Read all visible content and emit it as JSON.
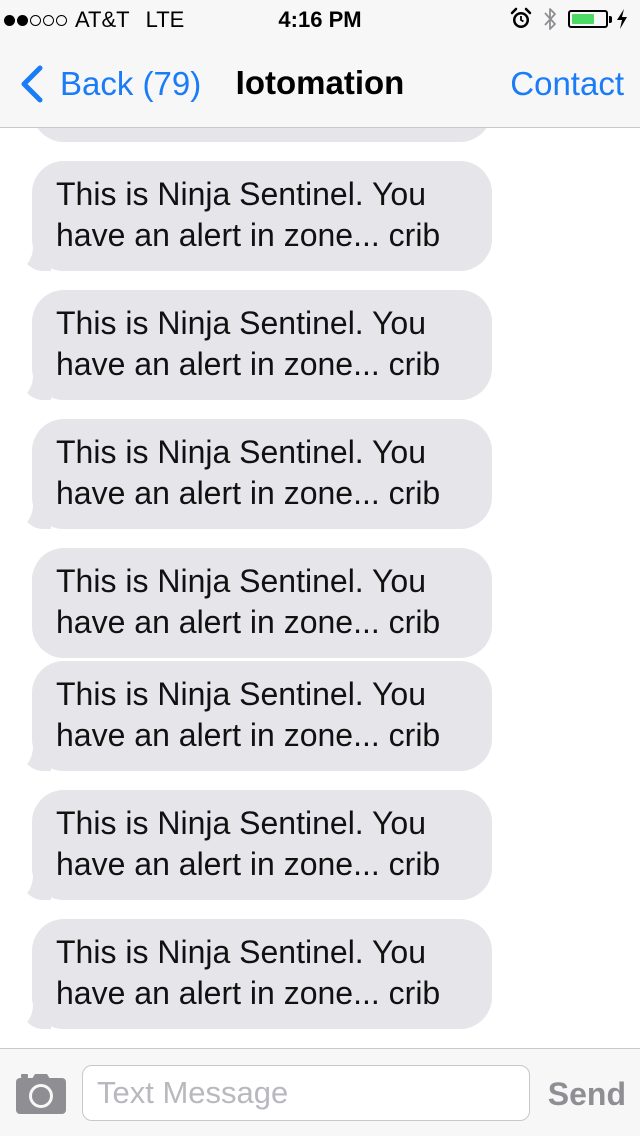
{
  "status_bar": {
    "signal_bars_filled": 2,
    "signal_bars_total": 5,
    "carrier": "AT&T",
    "network": "LTE",
    "time": "4:16 PM",
    "icons": [
      "alarm-icon",
      "bluetooth-icon",
      "battery-icon",
      "charging-icon"
    ],
    "battery_level": 0.68
  },
  "nav": {
    "back_label": "Back (79)",
    "title": "Iotomation",
    "contact_label": "Contact"
  },
  "messages": [
    "This is Ninja Sentinel. You have an alert in zone... crib",
    "This is Ninja Sentinel. You have an alert in zone... crib",
    "This is Ninja Sentinel. You have an alert in zone... crib",
    "This is Ninja Sentinel. You have an alert in zone... crib",
    "This is Ninja Sentinel. You have an alert in zone... crib",
    "This is Ninja Sentinel. You have an alert in zone... crib",
    "This is Ninja Sentinel. You have an alert in zone... crib"
  ],
  "input_bar": {
    "placeholder": "Text Message",
    "send_label": "Send"
  },
  "colors": {
    "accent": "#1a7cf6",
    "bubble": "#e5e5ea",
    "bar_background": "#f7f7f8",
    "battery": "#4cd964"
  }
}
